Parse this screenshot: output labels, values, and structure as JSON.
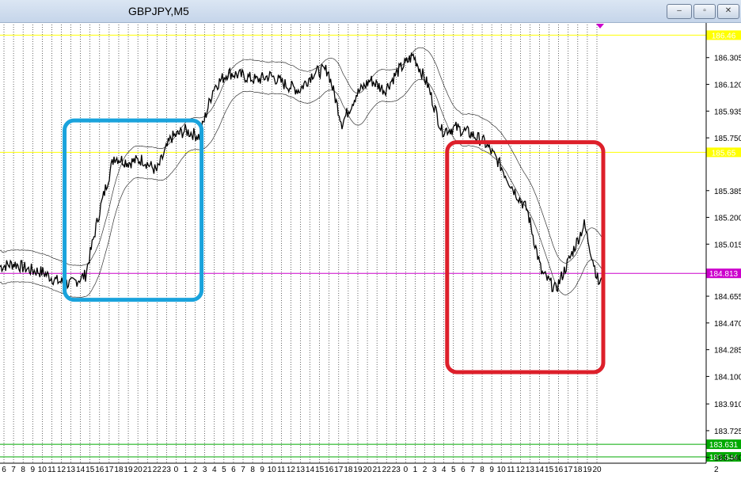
{
  "window": {
    "title": "GBPJPY,M5",
    "minimize_label": "–",
    "restore_label": "▫",
    "close_label": "✕"
  },
  "chart_data": {
    "type": "line",
    "title": "GBPJPY,M5",
    "ylim": [
      183.5,
      186.55
    ],
    "y_ticks": [
      "186.305",
      "186.120",
      "185.935",
      "185.750",
      "185.385",
      "185.200",
      "185.015",
      "184.655",
      "184.470",
      "184.285",
      "184.100",
      "183.910",
      "183.725",
      "183.540"
    ],
    "x_ticks": [
      "6",
      "7",
      "8",
      "9",
      "10",
      "11",
      "12",
      "13",
      "14",
      "15",
      "16",
      "17",
      "18",
      "19",
      "20",
      "21",
      "22",
      "23",
      "0",
      "1",
      "2",
      "3",
      "4",
      "5",
      "6",
      "7",
      "8",
      "9",
      "10",
      "11",
      "12",
      "13",
      "14",
      "15",
      "16",
      "17",
      "18",
      "19",
      "20",
      "21",
      "22",
      "23",
      "0",
      "1",
      "2",
      "3",
      "4",
      "5",
      "6",
      "7",
      "8",
      "9",
      "10",
      "11",
      "12",
      "13",
      "14",
      "15",
      "16",
      "17",
      "18",
      "19",
      "20"
    ],
    "bottom_right_tick": "2",
    "horizontal_lines": [
      {
        "value": 186.46,
        "color": "#ffff00",
        "label": "186.46"
      },
      {
        "value": 185.65,
        "color": "#ffff00",
        "label": "185.65"
      },
      {
        "value": 184.813,
        "color": "#cc00cc",
        "label": "184.813"
      },
      {
        "value": 183.631,
        "color": "#00aa00",
        "label": "183.631"
      },
      {
        "value": 183.544,
        "color": "#00aa00",
        "label": "183.544"
      }
    ],
    "price_x": [
      0,
      18,
      36,
      54,
      72,
      90,
      108,
      126,
      144,
      162,
      180,
      198,
      216,
      234,
      252,
      270,
      288,
      306,
      324,
      342,
      360,
      378,
      396,
      414,
      432,
      450,
      468,
      486,
      504,
      522,
      540,
      558,
      576,
      594,
      612,
      630,
      648,
      666,
      684,
      702,
      720,
      738,
      756
    ],
    "price": [
      184.86,
      184.88,
      184.84,
      184.82,
      184.76,
      184.74,
      184.8,
      185.25,
      185.62,
      185.58,
      185.6,
      185.52,
      185.75,
      185.8,
      185.76,
      186.1,
      186.2,
      186.18,
      186.15,
      186.18,
      186.12,
      186.08,
      186.2,
      186.22,
      185.85,
      186.05,
      186.15,
      186.08,
      186.22,
      186.32,
      186.12,
      185.8,
      185.82,
      185.78,
      185.72,
      185.58,
      185.4,
      185.25,
      184.82,
      184.7,
      184.92,
      185.15,
      184.75
    ],
    "series": [
      {
        "values": [
          184.86,
          184.88,
          184.84,
          184.82,
          184.76,
          184.74,
          184.8,
          185.25,
          185.62,
          185.58,
          185.6,
          185.52,
          185.75,
          185.8,
          185.76,
          186.1,
          186.2,
          186.18,
          186.15,
          186.18,
          186.12,
          186.08,
          186.2,
          186.22,
          185.85,
          186.05,
          186.15,
          186.08,
          186.22,
          186.32,
          186.12,
          185.8,
          185.82,
          185.78,
          185.72,
          185.58,
          185.4,
          185.25,
          184.82,
          184.7,
          184.92,
          185.15,
          184.75
        ]
      }
    ],
    "annotations": [
      {
        "shape": "rounded-rect",
        "color": "#1aa3dc",
        "x_from": "13",
        "x_to": "2",
        "y_from": 184.63,
        "y_to": 185.87
      },
      {
        "shape": "rounded-rect",
        "color": "#dd1f2a",
        "x_from": "5",
        "x_to": "20",
        "y_from": 184.13,
        "y_to": 185.72
      }
    ],
    "marker": {
      "color": "#cc00cc",
      "shape": "triangle-down"
    },
    "grid": true,
    "legend": "none"
  }
}
